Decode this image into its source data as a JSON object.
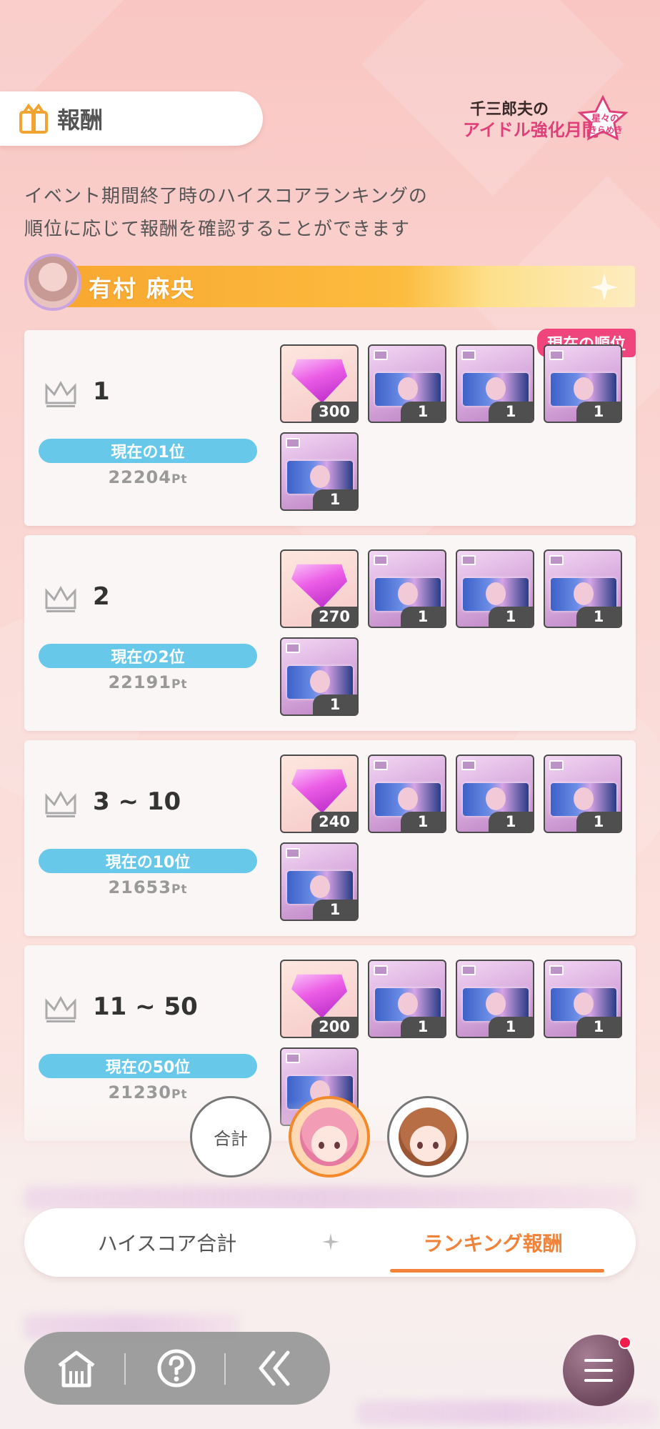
{
  "header": {
    "title": "報酬",
    "event_logo_text": "千三郎夫のアイドル強化月間 星々のきらめき"
  },
  "description": {
    "line1": "イベント期間終了時のハイスコアランキングの",
    "line2": "順位に応じて報酬を確認することができます"
  },
  "character": {
    "name": "有村 麻央"
  },
  "current_badge": "現在の順位",
  "ranks": [
    {
      "label": "1",
      "current_rank_text": "現在の1位",
      "points": "22204",
      "pt_unit": "Pt",
      "rewards": [
        {
          "type": "gem",
          "qty": "300"
        },
        {
          "type": "card",
          "qty": "1"
        },
        {
          "type": "card",
          "qty": "1"
        },
        {
          "type": "card",
          "qty": "1"
        },
        {
          "type": "card",
          "qty": "1"
        }
      ]
    },
    {
      "label": "2",
      "current_rank_text": "現在の2位",
      "points": "22191",
      "pt_unit": "Pt",
      "rewards": [
        {
          "type": "gem",
          "qty": "270"
        },
        {
          "type": "card",
          "qty": "1"
        },
        {
          "type": "card",
          "qty": "1"
        },
        {
          "type": "card",
          "qty": "1"
        },
        {
          "type": "card",
          "qty": "1"
        }
      ]
    },
    {
      "label": "3 ~ 10",
      "current_rank_text": "現在の10位",
      "points": "21653",
      "pt_unit": "Pt",
      "rewards": [
        {
          "type": "gem",
          "qty": "240"
        },
        {
          "type": "card",
          "qty": "1"
        },
        {
          "type": "card",
          "qty": "1"
        },
        {
          "type": "card",
          "qty": "1"
        },
        {
          "type": "card",
          "qty": "1"
        }
      ]
    },
    {
      "label": "11 ~ 50",
      "current_rank_text": "現在の50位",
      "points": "21230",
      "pt_unit": "Pt",
      "rewards": [
        {
          "type": "gem",
          "qty": "200"
        },
        {
          "type": "card",
          "qty": "1"
        },
        {
          "type": "card",
          "qty": "1"
        },
        {
          "type": "card",
          "qty": "1"
        },
        {
          "type": "card",
          "qty": ""
        }
      ]
    }
  ],
  "char_switch": {
    "total_label": "合計"
  },
  "tabs": {
    "high_score_total": "ハイスコア合計",
    "ranking_reward": "ランキング報酬",
    "active": "ランキング報酬"
  },
  "colors": {
    "accent": "#f0823a",
    "pill": "#68c8ea",
    "badge": "#f0457c",
    "bar": "#fcbc3e"
  }
}
